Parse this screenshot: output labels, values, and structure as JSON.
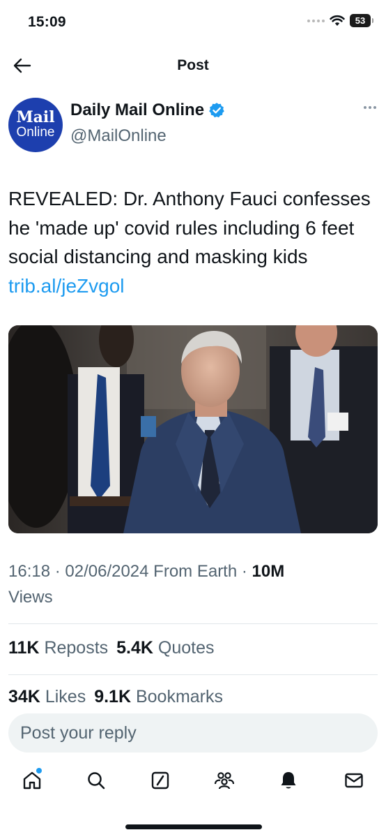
{
  "status_bar": {
    "time": "15:09",
    "battery": "53"
  },
  "header": {
    "title": "Post"
  },
  "author": {
    "name": "Daily Mail Online",
    "handle": "@MailOnline",
    "avatar_line1": "Mail",
    "avatar_line2": "Online"
  },
  "post": {
    "text": "REVEALED: Dr. Anthony Fauci confesses he 'made up' covid rules including 6 feet social distancing and masking kids ",
    "link": "trib.al/jeZvgol",
    "meta_time": "16:18 · 02/06/2024 From Earth · ",
    "views_count": "10M",
    "views_label": "Views"
  },
  "stats": {
    "reposts_count": "11K",
    "reposts_label": "Reposts",
    "quotes_count": "5.4K",
    "quotes_label": "Quotes",
    "likes_count": "34K",
    "likes_label": "Likes",
    "bookmarks_count": "9.1K",
    "bookmarks_label": "Bookmarks"
  },
  "reply": {
    "placeholder": "Post your reply"
  },
  "tabs": [
    "home-icon",
    "search-icon",
    "grok-icon",
    "communities-icon",
    "notifications-icon",
    "messages-icon"
  ],
  "colors": {
    "accent": "#1d9bf0",
    "text": "#0f1419",
    "muted": "#536471",
    "avatar_bg": "#1d3fae"
  }
}
